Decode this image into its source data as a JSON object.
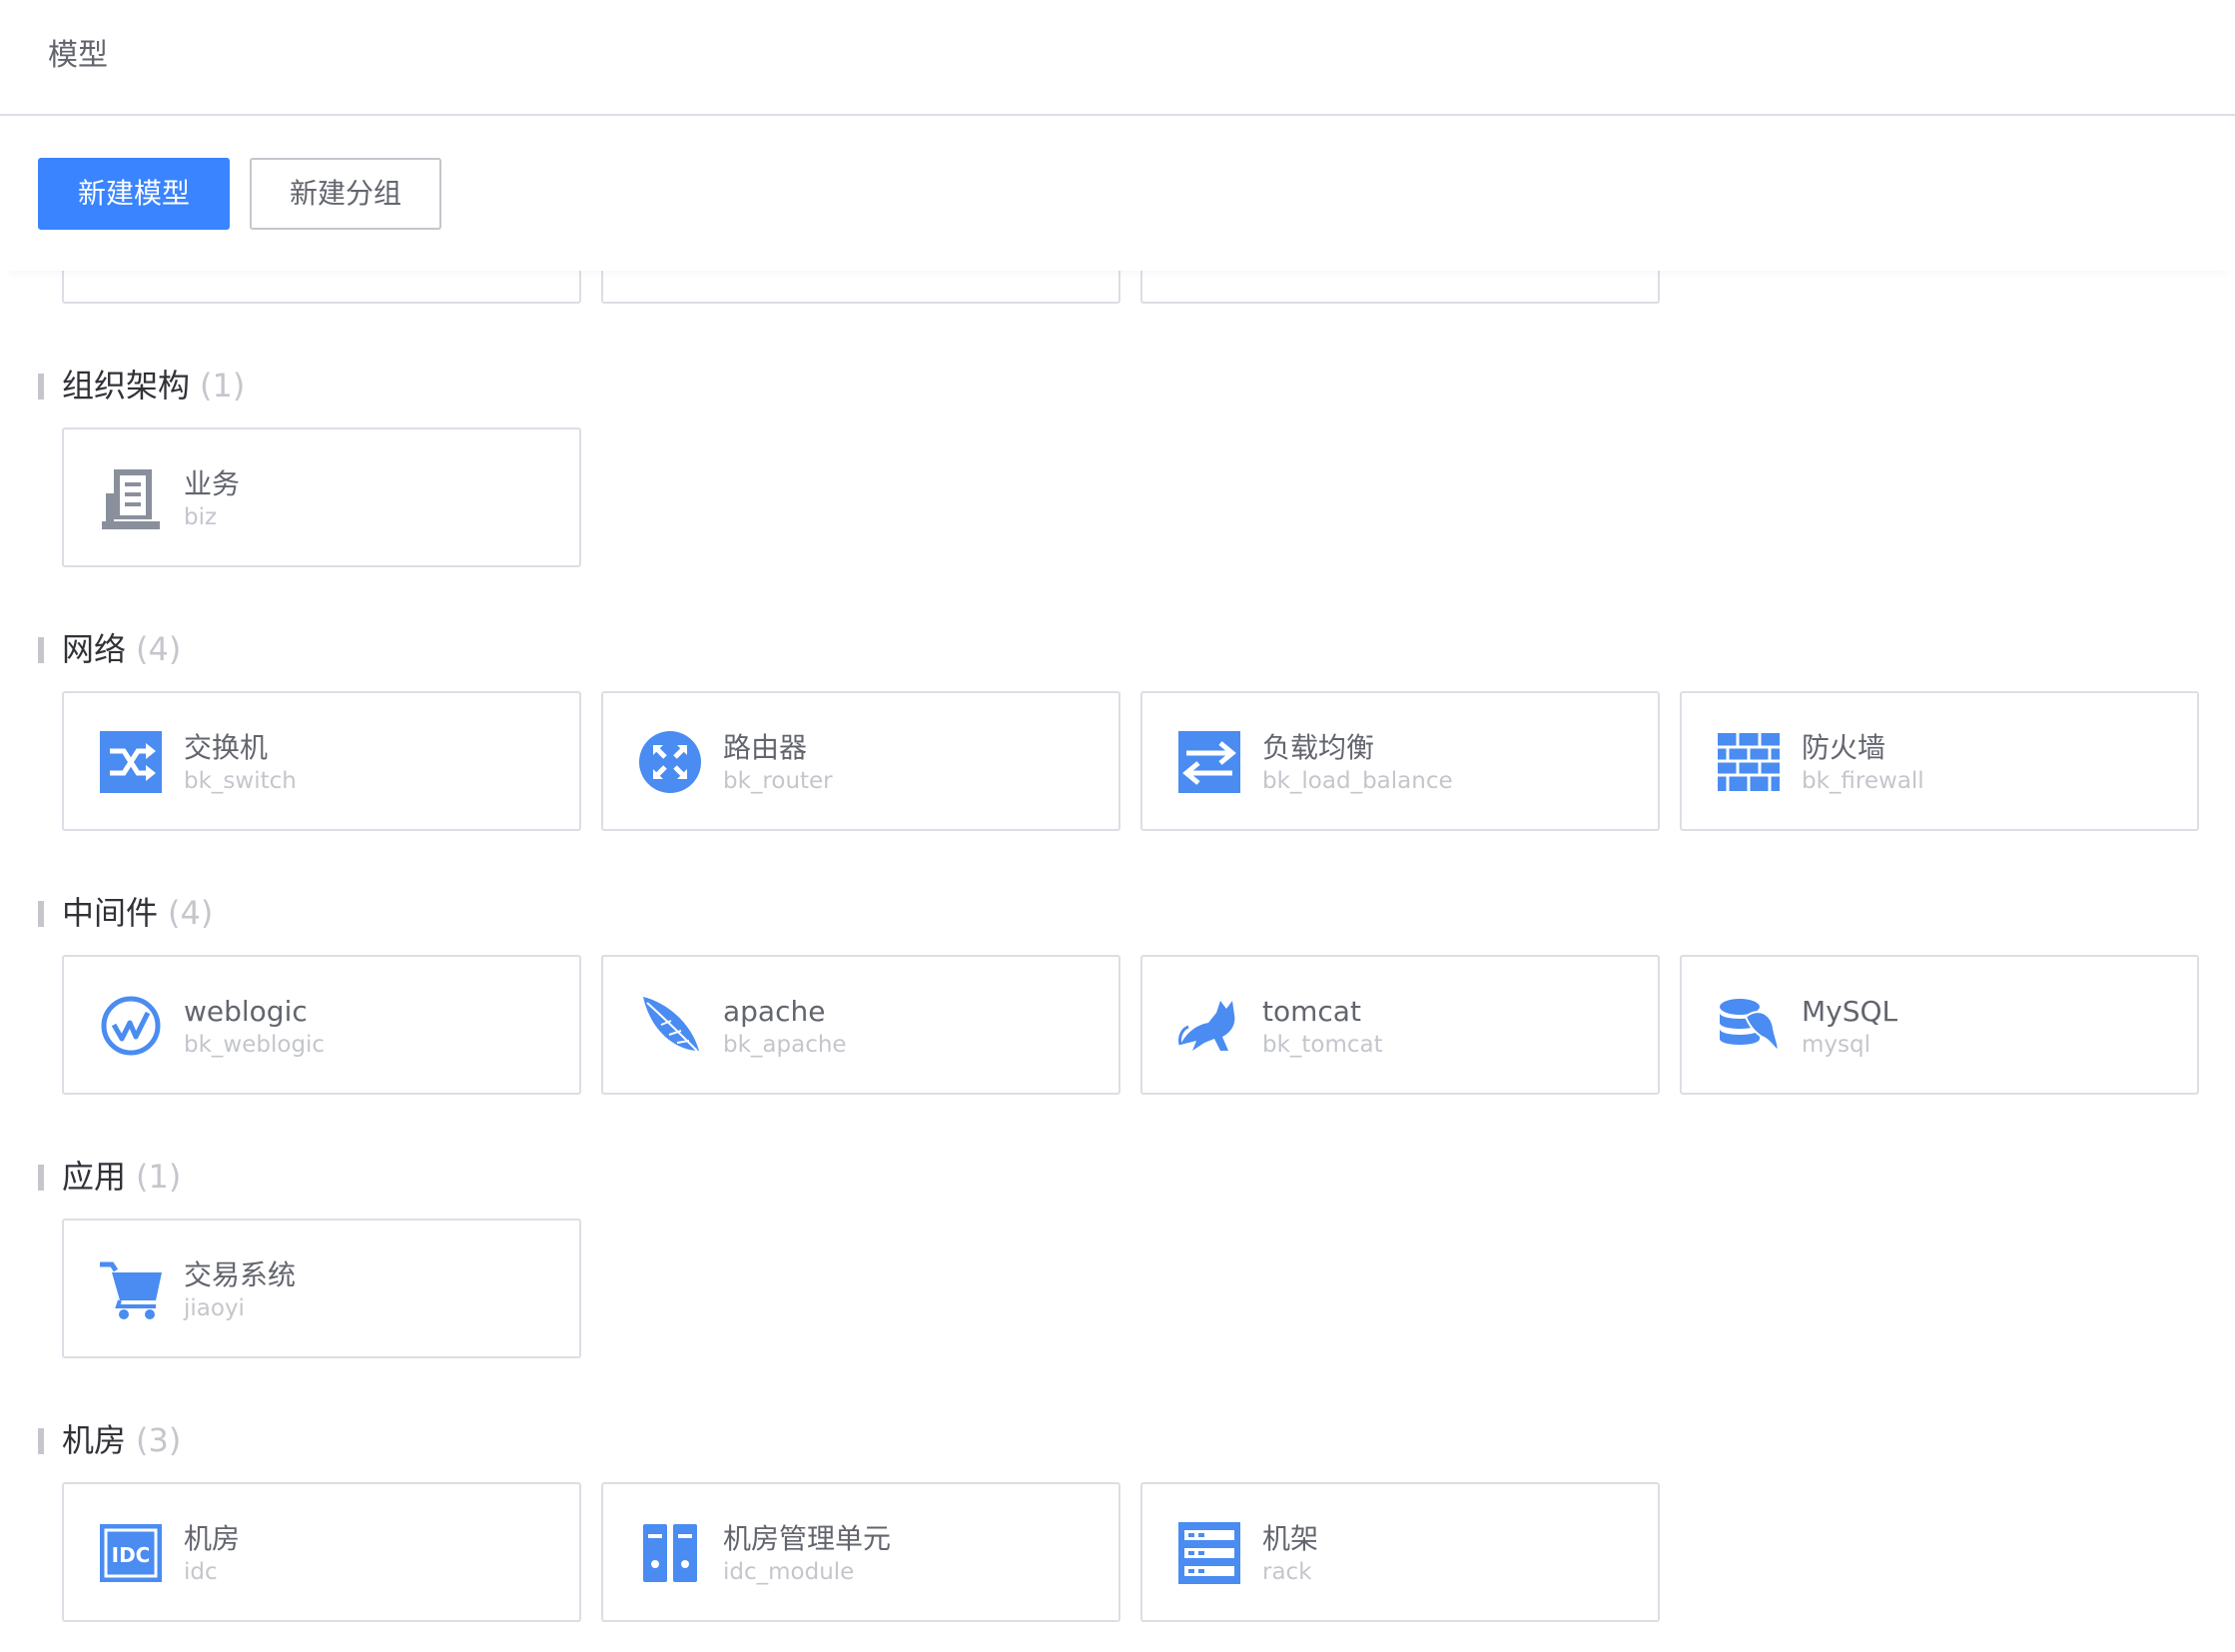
{
  "header": {
    "title": "模型"
  },
  "toolbar": {
    "new_model": "新建模型",
    "new_group": "新建分组"
  },
  "colors": {
    "primary": "#3a84ff",
    "icon_blue": "#4a8cf1",
    "icon_gray": "#8a8f9c",
    "border": "#dcdee5"
  },
  "groups": [
    {
      "title": "组织架构",
      "count": "(1)",
      "items": [
        {
          "name": "业务",
          "id": "biz",
          "icon": "biz-icon"
        }
      ]
    },
    {
      "title": "网络",
      "count": "(4)",
      "items": [
        {
          "name": "交换机",
          "id": "bk_switch",
          "icon": "switch-icon"
        },
        {
          "name": "路由器",
          "id": "bk_router",
          "icon": "router-icon"
        },
        {
          "name": "负载均衡",
          "id": "bk_load_balance",
          "icon": "load-balance-icon"
        },
        {
          "name": "防火墙",
          "id": "bk_firewall",
          "icon": "firewall-icon"
        }
      ]
    },
    {
      "title": "中间件",
      "count": "(4)",
      "items": [
        {
          "name": "weblogic",
          "id": "bk_weblogic",
          "icon": "weblogic-icon"
        },
        {
          "name": "apache",
          "id": "bk_apache",
          "icon": "apache-feather-icon"
        },
        {
          "name": "tomcat",
          "id": "bk_tomcat",
          "icon": "tomcat-icon"
        },
        {
          "name": "MySQL",
          "id": "mysql",
          "icon": "mysql-icon"
        }
      ]
    },
    {
      "title": "应用",
      "count": "(1)",
      "items": [
        {
          "name": "交易系统",
          "id": "jiaoyi",
          "icon": "shopping-cart-icon"
        }
      ]
    },
    {
      "title": "机房",
      "count": "(3)",
      "items": [
        {
          "name": "机房",
          "id": "idc",
          "icon": "idc-icon"
        },
        {
          "name": "机房管理单元",
          "id": "idc_module",
          "icon": "idc-module-icon"
        },
        {
          "name": "机架",
          "id": "rack",
          "icon": "rack-icon"
        }
      ]
    }
  ]
}
